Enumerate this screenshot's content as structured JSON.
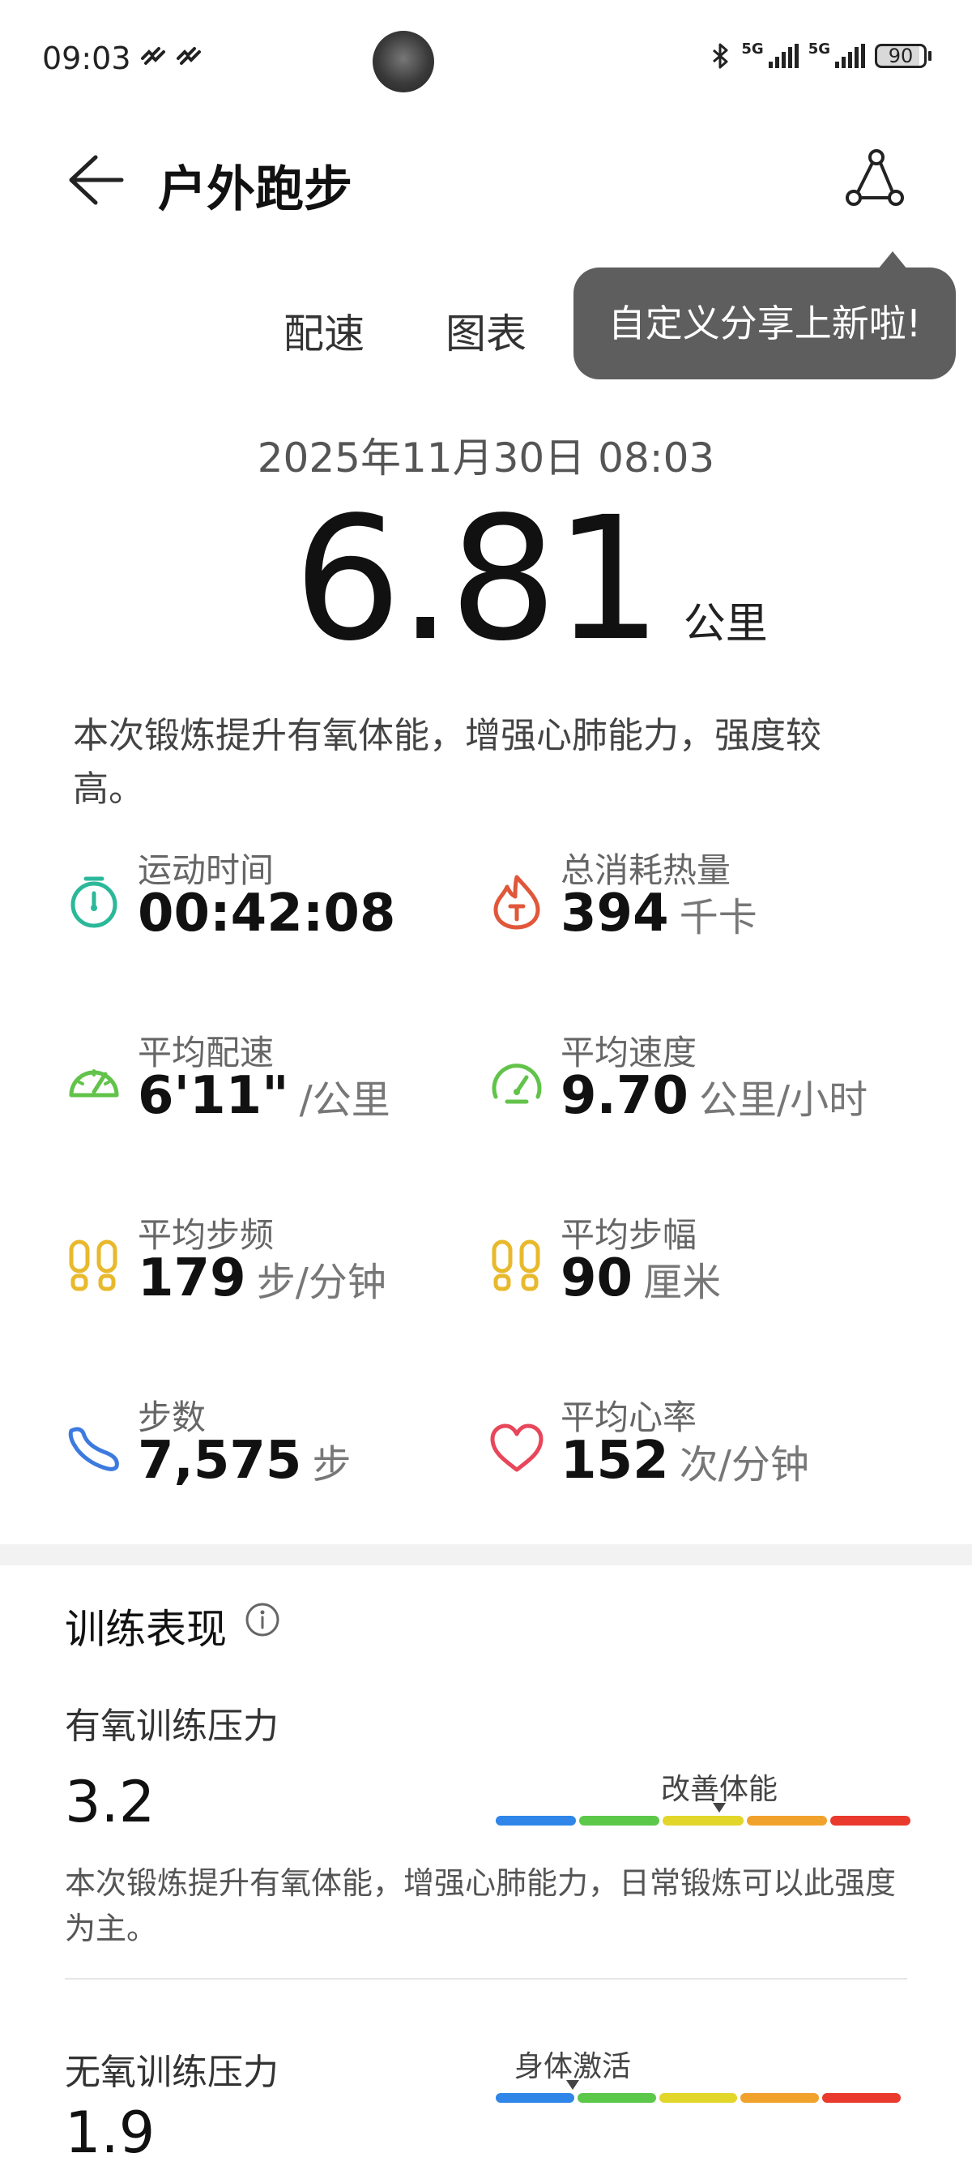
{
  "status_bar": {
    "time": "09:03",
    "network_1": "5G",
    "network_2": "5G",
    "battery": "90"
  },
  "header": {
    "title": "户外跑步"
  },
  "tabs": [
    {
      "label": "配速"
    },
    {
      "label": "图表"
    }
  ],
  "tooltip": {
    "text": "自定义分享上新啦!"
  },
  "summary": {
    "datetime": "2025年11月30日 08:03",
    "distance": "6.81",
    "distance_unit": "公里",
    "description": "本次锻炼提升有氧体能，增强心肺能力，强度较高。"
  },
  "metrics": [
    {
      "label": "运动时间",
      "value": "00:42:08",
      "unit": "",
      "icon": "stopwatch-icon",
      "color": "#2bb89a"
    },
    {
      "label": "总消耗热量",
      "value": "394",
      "unit": "千卡",
      "icon": "flame-icon",
      "color": "#e0573a"
    },
    {
      "label": "平均配速",
      "value": "6'11\"",
      "unit": "/公里",
      "icon": "speedometer-icon",
      "color": "#62c34a"
    },
    {
      "label": "平均速度",
      "value": "9.70",
      "unit": "公里/小时",
      "icon": "gauge-icon",
      "color": "#62c34a"
    },
    {
      "label": "平均步频",
      "value": "179",
      "unit": "步/分钟",
      "icon": "footprints-icon",
      "color": "#e8b92c"
    },
    {
      "label": "平均步幅",
      "value": "90",
      "unit": "厘米",
      "icon": "footprints-icon",
      "color": "#e8b92c"
    },
    {
      "label": "步数",
      "value": "7,575",
      "unit": "步",
      "icon": "shoe-icon",
      "color": "#3c7ae0"
    },
    {
      "label": "平均心率",
      "value": "152",
      "unit": "次/分钟",
      "icon": "heart-icon",
      "color": "#e8465a"
    }
  ],
  "training": {
    "title": "训练表现",
    "aerobic": {
      "label": "有氧训练压力",
      "value": "3.2",
      "level_caption": "改善体能",
      "level_fraction": 0.54,
      "description": "本次锻炼提升有氧体能，增强心肺能力，日常锻炼可以此强度为主。"
    },
    "anaerobic": {
      "label": "无氧训练压力",
      "value": "1.9",
      "level_caption": "身体激活",
      "level_fraction": 0.19
    },
    "scale_colors": [
      "#2f86e8",
      "#5cc84a",
      "#e3d62a",
      "#f1a22c",
      "#ea3a2e"
    ]
  }
}
